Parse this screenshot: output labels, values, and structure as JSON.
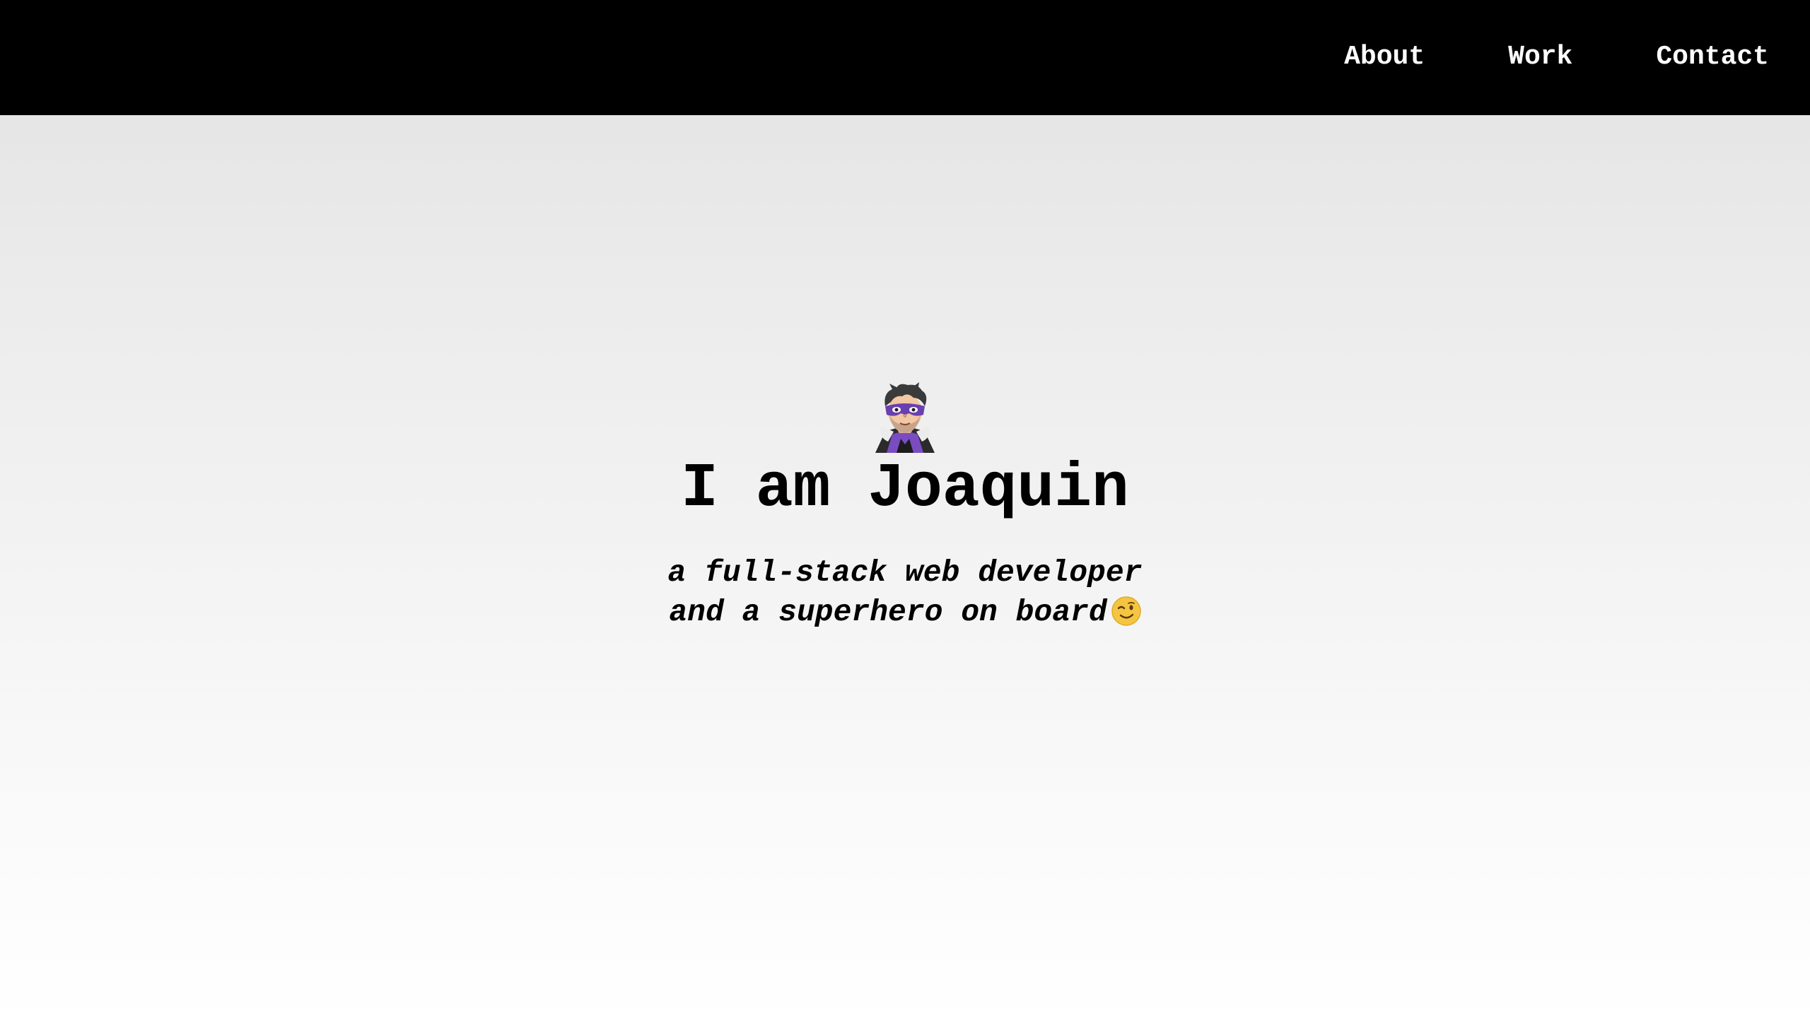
{
  "nav": {
    "links": [
      {
        "label": "About"
      },
      {
        "label": "Work"
      },
      {
        "label": "Contact"
      }
    ]
  },
  "hero": {
    "avatar_icon": "superhero-icon",
    "title": "I am Joaquin",
    "subtitle_line1": "a full-stack web developer",
    "subtitle_line2": "and a superhero on board",
    "subtitle_emoji_icon": "winking-face-icon"
  },
  "colors": {
    "navbar_bg": "#000000",
    "nav_text": "#ffffff",
    "text": "#000000",
    "background_top": "#e2e2e2",
    "background_bottom": "#ffffff",
    "mask_purple": "#6a3fb0"
  }
}
